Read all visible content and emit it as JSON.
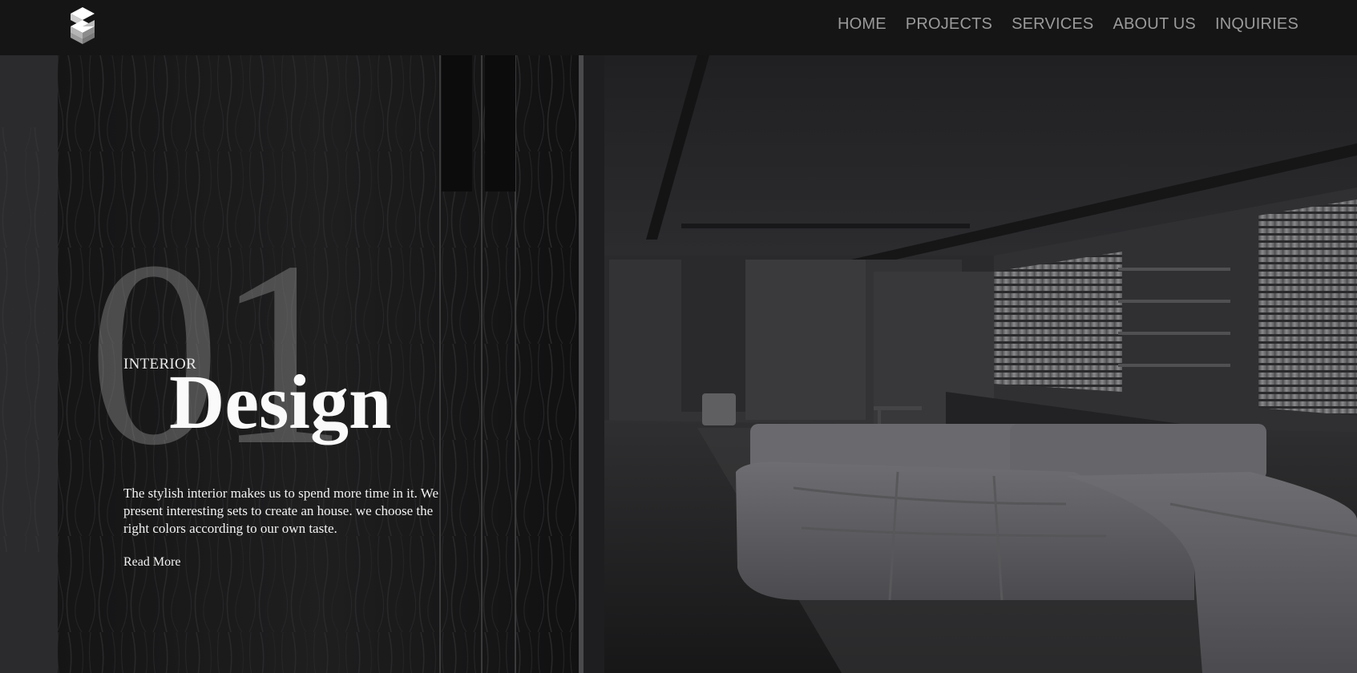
{
  "header": {
    "logo_icon": "cube-s-logo-icon",
    "nav": [
      {
        "label": "HOME"
      },
      {
        "label": "PROJECTS"
      },
      {
        "label": "SERVICES"
      },
      {
        "label": "ABOUT US"
      },
      {
        "label": "INQUIRIES"
      }
    ]
  },
  "hero": {
    "number": "01",
    "kicker": "INTERIOR",
    "headline": "Design",
    "description": "The stylish interior makes us to spend more time in it. We present interesting sets to create an house. we choose the right colors according to our own taste.",
    "read_more": "Read More",
    "background_image": "dark-living-room-photo"
  },
  "colors": {
    "header_bg": "#151515",
    "nav_text": "#9a9a9a",
    "hero_text": "#fafafa",
    "number_overlay": "#969696"
  }
}
